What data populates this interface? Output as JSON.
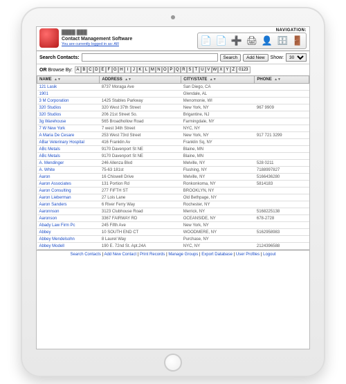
{
  "header": {
    "siteName": "████ ███",
    "subtitle": "Contact Management Software",
    "loginStatus": "You are currently logged in as: AR",
    "navLabel": "NAVIGATION:"
  },
  "toolbar": {
    "searchLabel": "Search Contacts:",
    "searchButton": "Search",
    "addNewButton": "Add New",
    "showLabel": "Show:",
    "showValue": "30",
    "browseLabel": "OR Browse By:",
    "letters": [
      "A",
      "B",
      "C",
      "D",
      "E",
      "F",
      "G",
      "H",
      "I",
      "J",
      "K",
      "L",
      "M",
      "N",
      "O",
      "P",
      "Q",
      "R",
      "S",
      "T",
      "U",
      "V",
      "W",
      "X",
      "Y",
      "Z",
      "0123"
    ]
  },
  "columns": {
    "name": "NAME",
    "address": "ADDRESS",
    "city": "CITY/STATE",
    "phone": "PHONE"
  },
  "rows": [
    {
      "name": "121 Lasik",
      "address": "8737 Moraga Ave",
      "city": "San Diego, CA",
      "phone": ""
    },
    {
      "name": "1901",
      "address": "",
      "city": "Glendale, AL",
      "phone": ""
    },
    {
      "name": "3 M Corporation",
      "address": "1425 Stables Parkway",
      "city": "Menomonie, WI",
      "phone": ""
    },
    {
      "name": "320 Studios",
      "address": "320 West 37th Street",
      "city": "New York, NY",
      "phone": "967 9909"
    },
    {
      "name": "320 Studios",
      "address": "206 21st Street So.",
      "city": "Brigantine, NJ",
      "phone": ""
    },
    {
      "name": "3g Warehouse",
      "address": "565 Broadhollow Road",
      "city": "Farmingdale, NY",
      "phone": ""
    },
    {
      "name": "7 W New York",
      "address": "7 west 34th Street",
      "city": "NYC, NY",
      "phone": ""
    },
    {
      "name": "A Maria De Cesare",
      "address": "253 West 73rd Street",
      "city": "New York, NY",
      "phone": "917 721 3299"
    },
    {
      "name": "ABar Veterinary Hospital",
      "address": "416 Franklin Av",
      "city": "Franklin Sq, NY",
      "phone": ""
    },
    {
      "name": "ABc Metals",
      "address": "9170 Davenport St NE",
      "city": "Blaine, MN",
      "phone": ""
    },
    {
      "name": "ABc Metals",
      "address": "9170 Davenport St NE",
      "city": "Blaine, MN",
      "phone": ""
    },
    {
      "name": "A. Mendinger",
      "address": "246 Allenza Blvd",
      "city": "Melville, NY",
      "phone": "528 0211"
    },
    {
      "name": "A. White",
      "address": "75-63 181st",
      "city": "Flushing, NY",
      "phone": "7188997827"
    },
    {
      "name": "Aaron",
      "address": "16 Chiswell Drive",
      "city": "Melville, NY",
      "phone": "5166436280"
    },
    {
      "name": "Aaron Associates",
      "address": "131 Portion Rd",
      "city": "Ronkonkoma, NY",
      "phone": "5814183"
    },
    {
      "name": "Aaron Consulting",
      "address": "277 FIFTH ST",
      "city": "BROOKLYN, NY",
      "phone": ""
    },
    {
      "name": "Aaron Lieberman",
      "address": "27 Lois Lane",
      "city": "Old Bethpage, NY",
      "phone": ""
    },
    {
      "name": "Aaron Sanders",
      "address": "6 River Ferry Way",
      "city": "Rochester, NY",
      "phone": ""
    },
    {
      "name": "Aaronnson",
      "address": "3123 Clubhouse Road",
      "city": "Merrick, NY",
      "phone": "5168225138"
    },
    {
      "name": "Aaronson",
      "address": "3367 FAIRWAY RD",
      "city": "OCEANSIDE, NY",
      "phone": "678-2728"
    },
    {
      "name": "Abady Law Firm Pc",
      "address": "245 Fifth Ave",
      "city": "New York, NY",
      "phone": ""
    },
    {
      "name": "Abbey",
      "address": "10 SOUTH END CT",
      "city": "WOODMERE, NY",
      "phone": "5162958983"
    },
    {
      "name": "Abbey Mendelsohn",
      "address": "8 Laurel Way",
      "city": "Purchase, NY",
      "phone": ""
    },
    {
      "name": "Abbey Modell",
      "address": "190 E. 72nd St. Apt.24A",
      "city": "NYC, NY",
      "phone": "2124396588"
    }
  ],
  "footer": {
    "links": [
      "Search Contacts",
      "Add New Contact",
      "Print Records",
      "Manage Groups",
      "Export Database",
      "User Profiles",
      "Logout"
    ]
  }
}
